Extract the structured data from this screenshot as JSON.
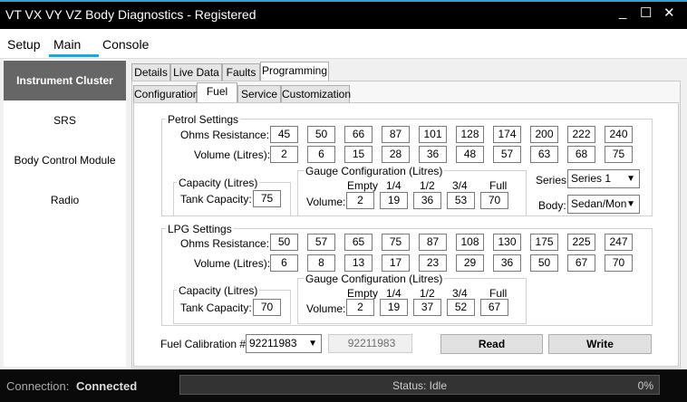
{
  "window": {
    "title": "VT VX VY VZ Body Diagnostics - Registered",
    "min": "_",
    "max": "☐",
    "close": "✕"
  },
  "menu": {
    "setup": "Setup",
    "main": "Main",
    "console": "Console"
  },
  "sidebar": {
    "items": [
      {
        "label": "Instrument Cluster"
      },
      {
        "label": "SRS"
      },
      {
        "label": "Body Control Module"
      },
      {
        "label": "Radio"
      }
    ]
  },
  "tabs_top": [
    {
      "label": "Details"
    },
    {
      "label": "Live Data"
    },
    {
      "label": "Faults"
    },
    {
      "label": "Programming"
    }
  ],
  "tabs_sub": [
    {
      "label": "Configuration"
    },
    {
      "label": "Fuel"
    },
    {
      "label": "Service"
    },
    {
      "label": "Customization"
    }
  ],
  "petrol": {
    "title": "Petrol Settings",
    "ohms_label": "Ohms Resistance:",
    "volume_label": "Volume (Litres):",
    "ohms": [
      "45",
      "50",
      "66",
      "87",
      "101",
      "128",
      "174",
      "200",
      "222",
      "240"
    ],
    "volume": [
      "2",
      "6",
      "15",
      "28",
      "36",
      "48",
      "57",
      "63",
      "68",
      "75"
    ],
    "capacity_title": "Capacity (Litres)",
    "tank_label": "Tank Capacity:",
    "tank": "75",
    "gauge_title": "Gauge Configuration (Litres)",
    "gauge_headers": [
      "Empty",
      "1/4",
      "1/2",
      "3/4",
      "Full"
    ],
    "gauge_volume_label": "Volume:",
    "gauge_values": [
      "2",
      "19",
      "36",
      "53",
      "70"
    ],
    "series_label": "Series:",
    "series_value": "Series 1",
    "body_label": "Body:",
    "body_value": "Sedan/Mon"
  },
  "lpg": {
    "title": "LPG Settings",
    "ohms_label": "Ohms Resistance:",
    "volume_label": "Volume (Litres):",
    "ohms": [
      "50",
      "57",
      "65",
      "75",
      "87",
      "108",
      "130",
      "175",
      "225",
      "247"
    ],
    "volume": [
      "6",
      "8",
      "13",
      "17",
      "23",
      "29",
      "36",
      "50",
      "67",
      "70"
    ],
    "capacity_title": "Capacity (Litres)",
    "tank_label": "Tank Capacity:",
    "tank": "70",
    "gauge_title": "Gauge Configuration (Litres)",
    "gauge_headers": [
      "Empty",
      "1/4",
      "1/2",
      "3/4",
      "Full"
    ],
    "gauge_volume_label": "Volume:",
    "gauge_values": [
      "2",
      "19",
      "37",
      "52",
      "67"
    ]
  },
  "calibration": {
    "label": "Fuel Calibration #:",
    "value": "92211983",
    "readonly": "92211983"
  },
  "buttons": {
    "read": "Read",
    "write": "Write"
  },
  "status": {
    "connection_label": "Connection:",
    "connection_value": "Connected",
    "status_text": "Status: Idle",
    "progress_text": "0%",
    "progress": 0
  }
}
